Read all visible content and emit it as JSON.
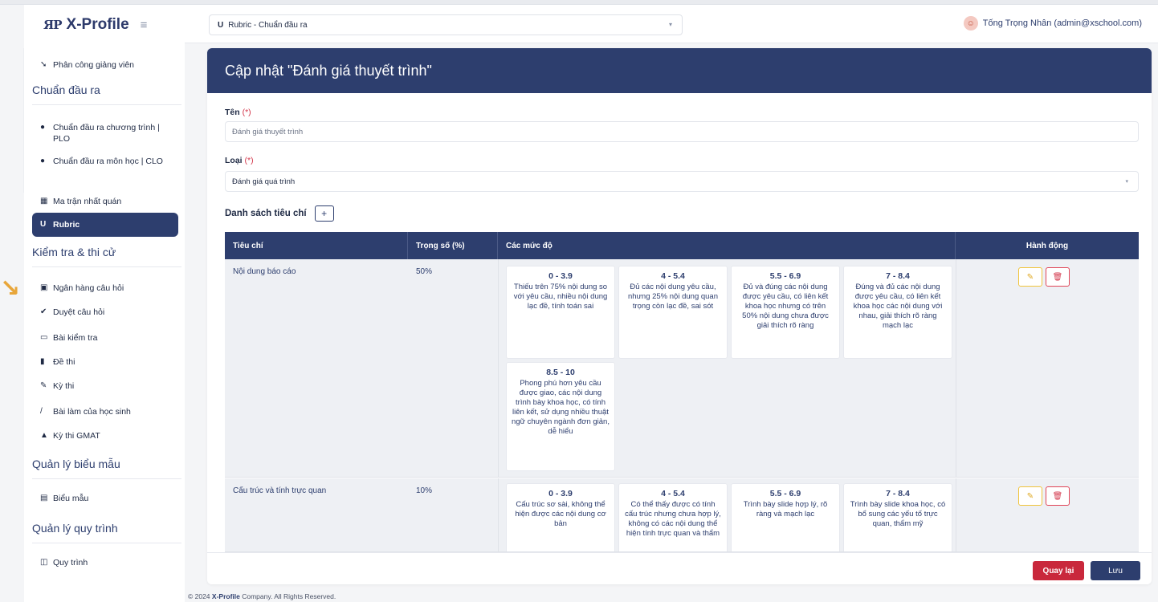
{
  "brand": {
    "logo": "ЯP",
    "name": "X-Profile",
    "menu_icon": "hamburger-icon"
  },
  "header": {
    "rubric_select": "Rubric - Chuẩn đầu ra",
    "user": "Tống Trọng Nhân (admin@xschool.com)"
  },
  "sidebar": {
    "items": [
      {
        "label": "Phân công giảng viên",
        "icon": "assign-icon"
      },
      {
        "label": "Chuẩn đầu ra chương trình | PLO",
        "icon": "dot-icon"
      },
      {
        "label": "Chuẩn đầu ra môn học | CLO",
        "icon": "dot-icon"
      },
      {
        "label": "Ma trận nhất quán",
        "icon": "grid-icon"
      },
      {
        "label": "Rubric",
        "icon": "rubric-icon"
      },
      {
        "label": "Ngân hàng câu hỏi",
        "icon": "bank-icon"
      },
      {
        "label": "Duyệt câu hỏi",
        "icon": "check-icon"
      },
      {
        "label": "Bài kiểm tra",
        "icon": "test-icon"
      },
      {
        "label": "Đề thi",
        "icon": "exam-icon"
      },
      {
        "label": "Kỳ thi",
        "icon": "pen-icon"
      },
      {
        "label": "Bài làm của học sinh",
        "icon": "student-icon"
      },
      {
        "label": "Kỳ thi GMAT",
        "icon": "graduation-icon"
      },
      {
        "label": "Biểu mẫu",
        "icon": "form-icon"
      },
      {
        "label": "Quy trình",
        "icon": "process-icon"
      }
    ],
    "sections": [
      "Chuẩn đầu ra",
      "Kiểm tra & thi cử",
      "Quản lý biểu mẫu",
      "Quản lý quy trình"
    ]
  },
  "form": {
    "title": "Cập nhật \"Đánh giá thuyết trình\"",
    "name_label": "Tên",
    "required_mark": "(*)",
    "name_value": "Đánh giá thuyết trình",
    "type_label": "Loại",
    "type_value": "Đánh giá quá trình",
    "criteria_heading": "Danh sách tiêu chí",
    "add_label": "+"
  },
  "table": {
    "headers": [
      "Tiêu chí",
      "Trọng số (%)",
      "Các mức độ",
      "Hành động"
    ],
    "rows": [
      {
        "criterion": "Nội dung báo cáo",
        "weight": "50%",
        "levels": [
          {
            "range": "0 - 3.9",
            "desc": "Thiếu trên 75% nội dung so với yêu cầu, nhiều nội dung lạc đề, tính toán sai"
          },
          {
            "range": "4 - 5.4",
            "desc": "Đủ các nội dung yêu cầu, nhưng 25% nội dung quan trọng còn lạc đề, sai sót"
          },
          {
            "range": "5.5 - 6.9",
            "desc": "Đủ và đúng các nội dung được yêu cầu, có liên kết khoa học nhưng có trên 50% nội dung chưa được giải thích rõ ràng"
          },
          {
            "range": "7 - 8.4",
            "desc": "Đúng và đủ các nội dung được yêu cầu, có liên kết khoa học các nội dung với nhau, giải thích rõ ràng mạch lạc"
          },
          {
            "range": "8.5 - 10",
            "desc": "Phong phú hơn yêu cầu được giao, các nội dung trình bày khoa học, có tính liên kết, sử dụng nhiều thuật ngữ chuyên ngành đơn giản, dễ hiểu"
          }
        ]
      },
      {
        "criterion": "Cấu trúc và tính trực quan",
        "weight": "10%",
        "levels": [
          {
            "range": "0 - 3.9",
            "desc": "Cấu trúc sơ sài, không thể hiện được các nội dung cơ bản"
          },
          {
            "range": "4 - 5.4",
            "desc": "Có thể thấy được có tính cấu trúc nhưng chưa hợp lý, không có các nội dung thể hiện tính trực quan và thẩm"
          },
          {
            "range": "5.5 - 6.9",
            "desc": "Trình bày slide hợp lý, rõ ràng và mạch lạc"
          },
          {
            "range": "7 - 8.4",
            "desc": "Trình bày slide khoa học, có bổ sung các yếu tố trực quan, thẩm mỹ"
          }
        ]
      }
    ]
  },
  "buttons": {
    "back": "Quay lại",
    "save": "Lưu"
  },
  "footer": {
    "prefix": "© 2024 ",
    "company": "X-Profile",
    "suffix": " Company. All Rights Reserved."
  },
  "colors": {
    "primary": "#2d3e6e",
    "danger": "#c9283c",
    "warning": "#f0c43a"
  }
}
